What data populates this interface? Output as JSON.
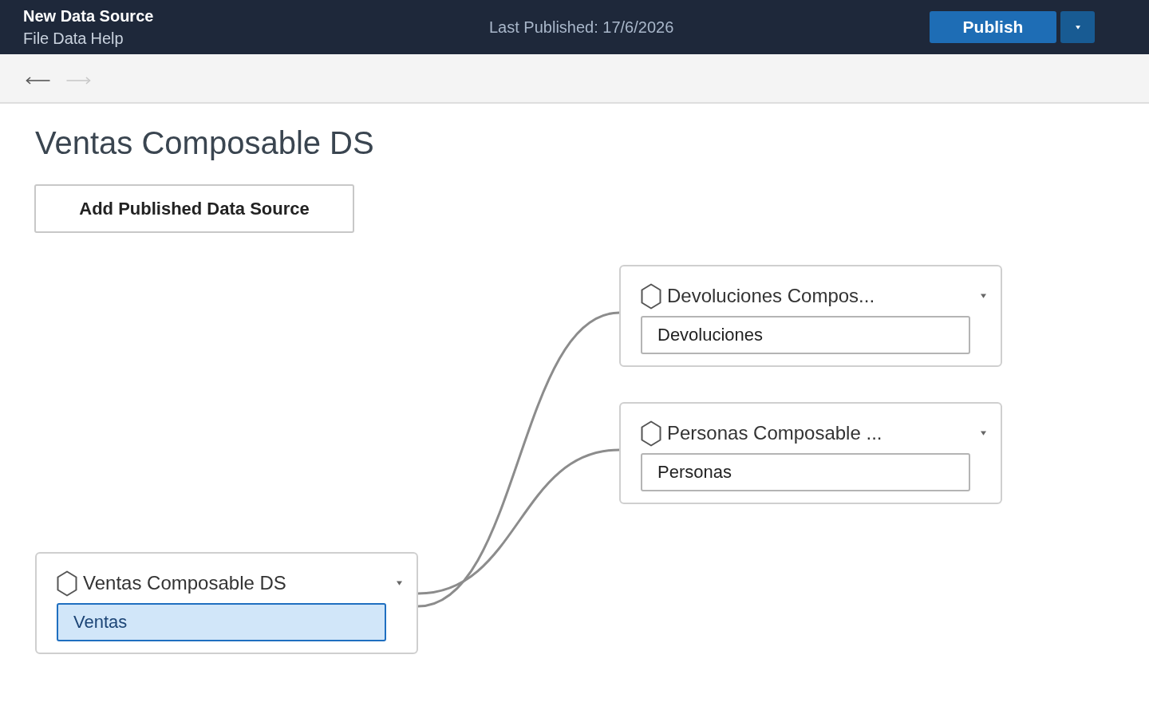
{
  "header": {
    "title": "New Data Source",
    "menu": [
      "File",
      "Data",
      "Help"
    ],
    "last_published": "Last Published: 17/6/2026",
    "publish_button": "Publish"
  },
  "navigation": [
    {
      "kind": "back",
      "disabled": false
    },
    {
      "kind": "forward",
      "disabled": true
    }
  ],
  "page_title": "Ventas Composable DS",
  "add_button": "Add Published Data Source",
  "canvas": {
    "root": {
      "title": "Ventas Composable DS",
      "table": {
        "name": "Ventas",
        "selected": true
      },
      "children": [
        {
          "title": "Devoluciones Compos...",
          "table": {
            "name": "Devoluciones",
            "selected": false
          }
        },
        {
          "title": "Personas Composable ...",
          "table": {
            "name": "Personas",
            "selected": false
          }
        }
      ]
    }
  }
}
